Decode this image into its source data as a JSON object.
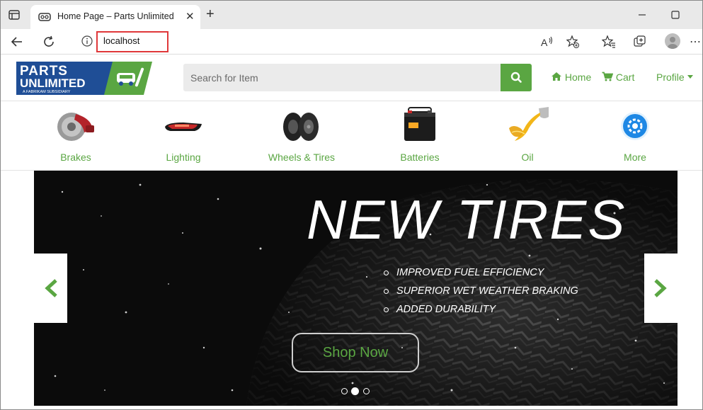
{
  "browser": {
    "tab_title": "Home Page – Parts Unlimited",
    "url": "localhost",
    "tab_close": "✕",
    "new_tab": "+"
  },
  "site": {
    "logo": {
      "line1": "PARTS",
      "line2": "UNLIMITED",
      "tagline": "A FABRIKAM SUBSIDIARY"
    },
    "search": {
      "placeholder": "Search for Item"
    },
    "nav": {
      "home": "Home",
      "cart": "Cart",
      "profile": "Profile"
    },
    "categories": [
      {
        "label": "Brakes",
        "icon": "brake-rotor-icon"
      },
      {
        "label": "Lighting",
        "icon": "headlight-icon"
      },
      {
        "label": "Wheels & Tires",
        "icon": "tires-icon"
      },
      {
        "label": "Batteries",
        "icon": "battery-icon"
      },
      {
        "label": "Oil",
        "icon": "oil-pour-icon"
      },
      {
        "label": "More",
        "icon": "more-gear-icon"
      }
    ]
  },
  "hero": {
    "title": "NEW TIRES",
    "features": [
      "IMPROVED FUEL EFFICIENCY",
      "SUPERIOR WET WEATHER BRAKING",
      "ADDED DURABILITY"
    ],
    "cta": "Shop Now",
    "slide_count": 3,
    "active_slide": 2
  },
  "colors": {
    "accent": "#5aa642",
    "logo_blue": "#1f4e96",
    "url_highlight": "#e0383a"
  }
}
